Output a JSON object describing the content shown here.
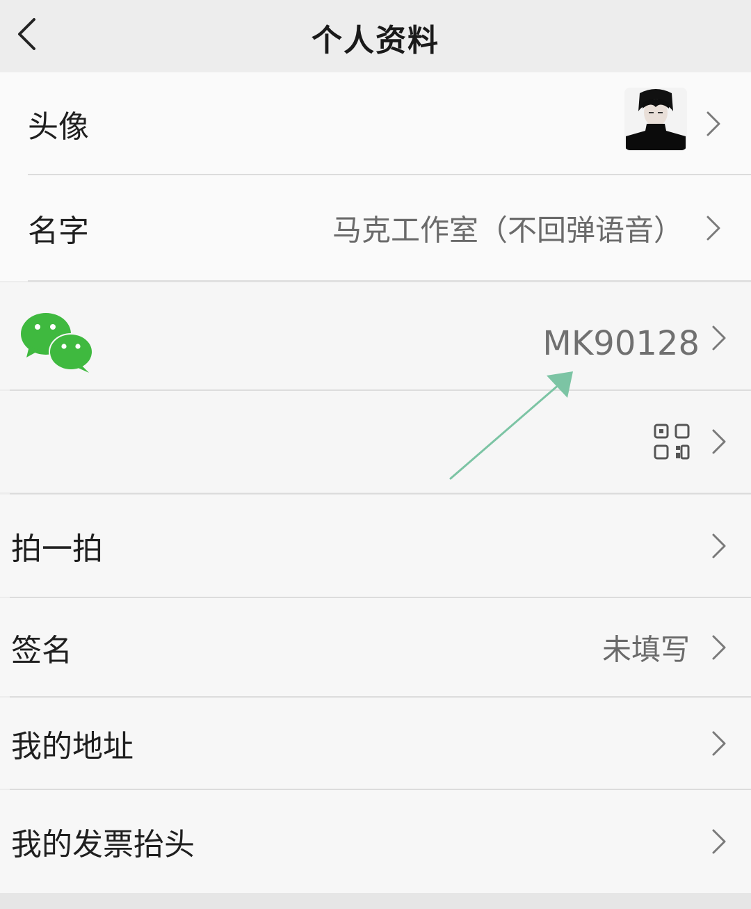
{
  "header": {
    "title": "个人资料"
  },
  "rows": {
    "avatar": {
      "label": "头像"
    },
    "name": {
      "label": "名字",
      "value": "马克工作室（不回弹语音）"
    },
    "wechat_id": {
      "value": "MK90128"
    },
    "qrcode": {},
    "pat": {
      "label": "拍一拍"
    },
    "signature": {
      "label": "签名",
      "value": "未填写"
    },
    "address": {
      "label": "我的地址"
    },
    "invoice": {
      "label": "我的发票抬头"
    }
  },
  "colors": {
    "background": "#ededed",
    "row_background": "#f9f9f9",
    "divider": "#dcdcdc",
    "wechat_green": "#3fb93f",
    "annotation_arrow": "#7cc4a4",
    "secondary_text": "#6a6a6a"
  },
  "icons": {
    "back": "chevron-left-icon",
    "chevron": "chevron-right-icon",
    "wechat": "wechat-logo-icon",
    "qrcode": "qr-code-icon"
  }
}
